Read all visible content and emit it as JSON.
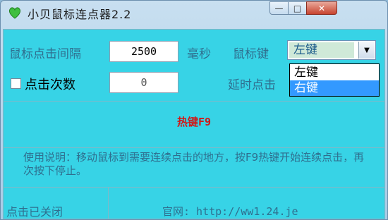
{
  "window": {
    "title": "小贝鼠标连点器2.2",
    "controls": {
      "minimize": "—",
      "maximize": "□",
      "close": "✕"
    }
  },
  "form": {
    "interval_label": "鼠标点击间隔",
    "interval_value": "2500",
    "interval_unit": "毫秒",
    "button_label": "鼠标键",
    "button_selected": "左键",
    "button_options": [
      "左键",
      "右键"
    ],
    "count_checkbox_label": "点击次数",
    "count_checked": false,
    "count_value": "0",
    "delay_label": "延时点击"
  },
  "hotkey": {
    "text": "热键F9",
    "color": "#d01818"
  },
  "description": "使用说明：移动鼠标到需要连续点击的地方，按F9热键开始连续点击，再次按下停止。",
  "status": {
    "state": "点击已关闭",
    "website": "官网: http://ww1.24.je"
  }
}
